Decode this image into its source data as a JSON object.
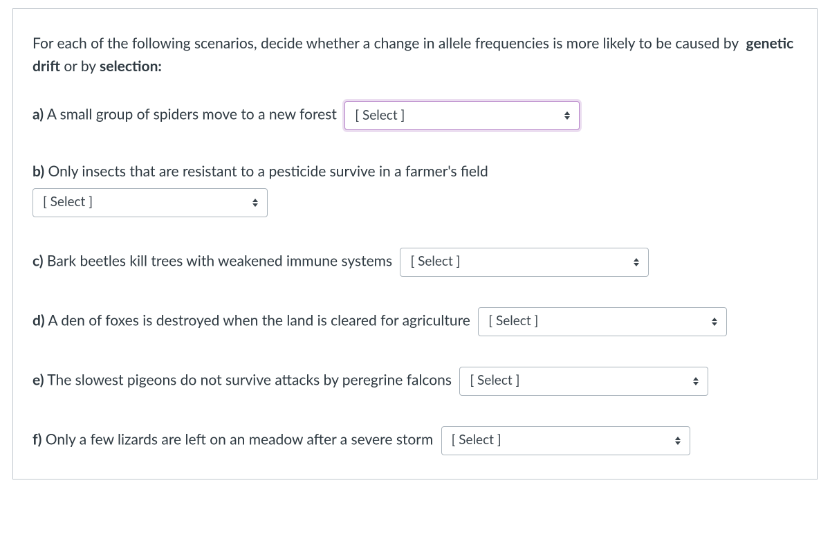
{
  "intro": {
    "lead": "For each of the following scenarios, decide whether a change in allele frequencies is more likely to be caused by ",
    "bold1": "genetic drift",
    "mid": " or by ",
    "bold2": "selection:",
    "tail": ""
  },
  "select_placeholder": "[ Select ]",
  "questions": {
    "a": {
      "label": "a)",
      "text": " A small group of spiders move to a new forest"
    },
    "b": {
      "label": "b)",
      "text": " Only insects that are resistant to a pesticide survive in a farmer's field"
    },
    "c": {
      "label": "c)",
      "text": " Bark beetles kill trees with weakened immune systems"
    },
    "d": {
      "label": "d)",
      "text": " A den of foxes is destroyed when the land is cleared for agriculture"
    },
    "e": {
      "label": "e)",
      "text": " The slowest pigeons do not survive attacks by peregrine falcons"
    },
    "f": {
      "label": "f)",
      "text": " Only a few lizards are left on an meadow after a severe storm"
    }
  }
}
